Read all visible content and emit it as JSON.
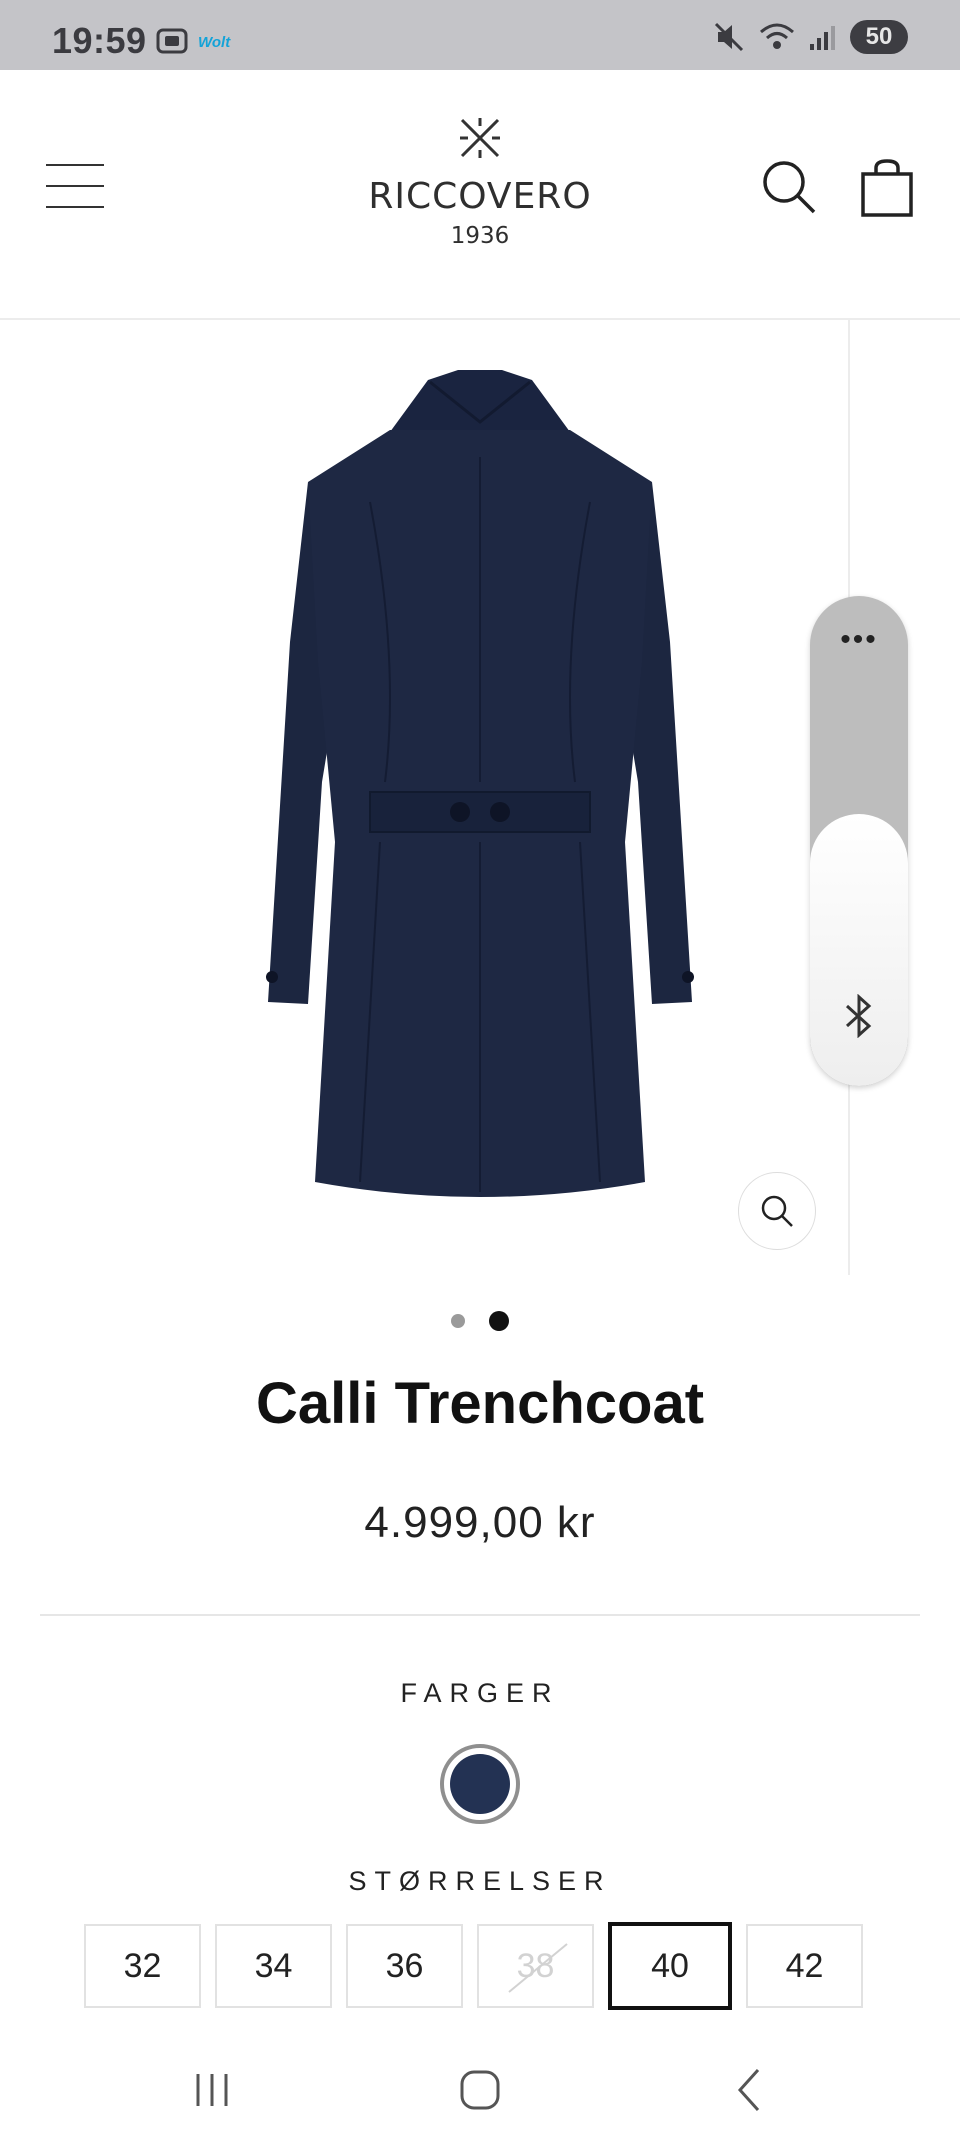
{
  "status_bar": {
    "time": "19:59",
    "app_label": "Wolt",
    "battery": "50"
  },
  "header": {
    "brand_name": "RICCOVERO",
    "brand_year": "1936"
  },
  "gallery": {
    "image_count": 2,
    "active_index": 2
  },
  "product": {
    "title": "Calli Trenchcoat",
    "price": "4.999,00 kr"
  },
  "colors": {
    "label": "FARGER",
    "options": [
      {
        "name": "navy",
        "hex": "#233253",
        "selected": true
      }
    ]
  },
  "sizes": {
    "label": "STØRRELSER",
    "options": [
      {
        "label": "32",
        "available": true,
        "selected": false
      },
      {
        "label": "34",
        "available": true,
        "selected": false
      },
      {
        "label": "36",
        "available": true,
        "selected": false
      },
      {
        "label": "38",
        "available": false,
        "selected": false
      },
      {
        "label": "40",
        "available": true,
        "selected": true
      },
      {
        "label": "42",
        "available": true,
        "selected": false
      }
    ]
  },
  "edge_panel": {
    "more_icon": "more-dots-icon",
    "bottom_icon": "bluetooth-icon"
  },
  "theme": {
    "accent": "#111111",
    "coat_color": "#1c2640",
    "status_bar_bg": "#c4c4c8"
  }
}
